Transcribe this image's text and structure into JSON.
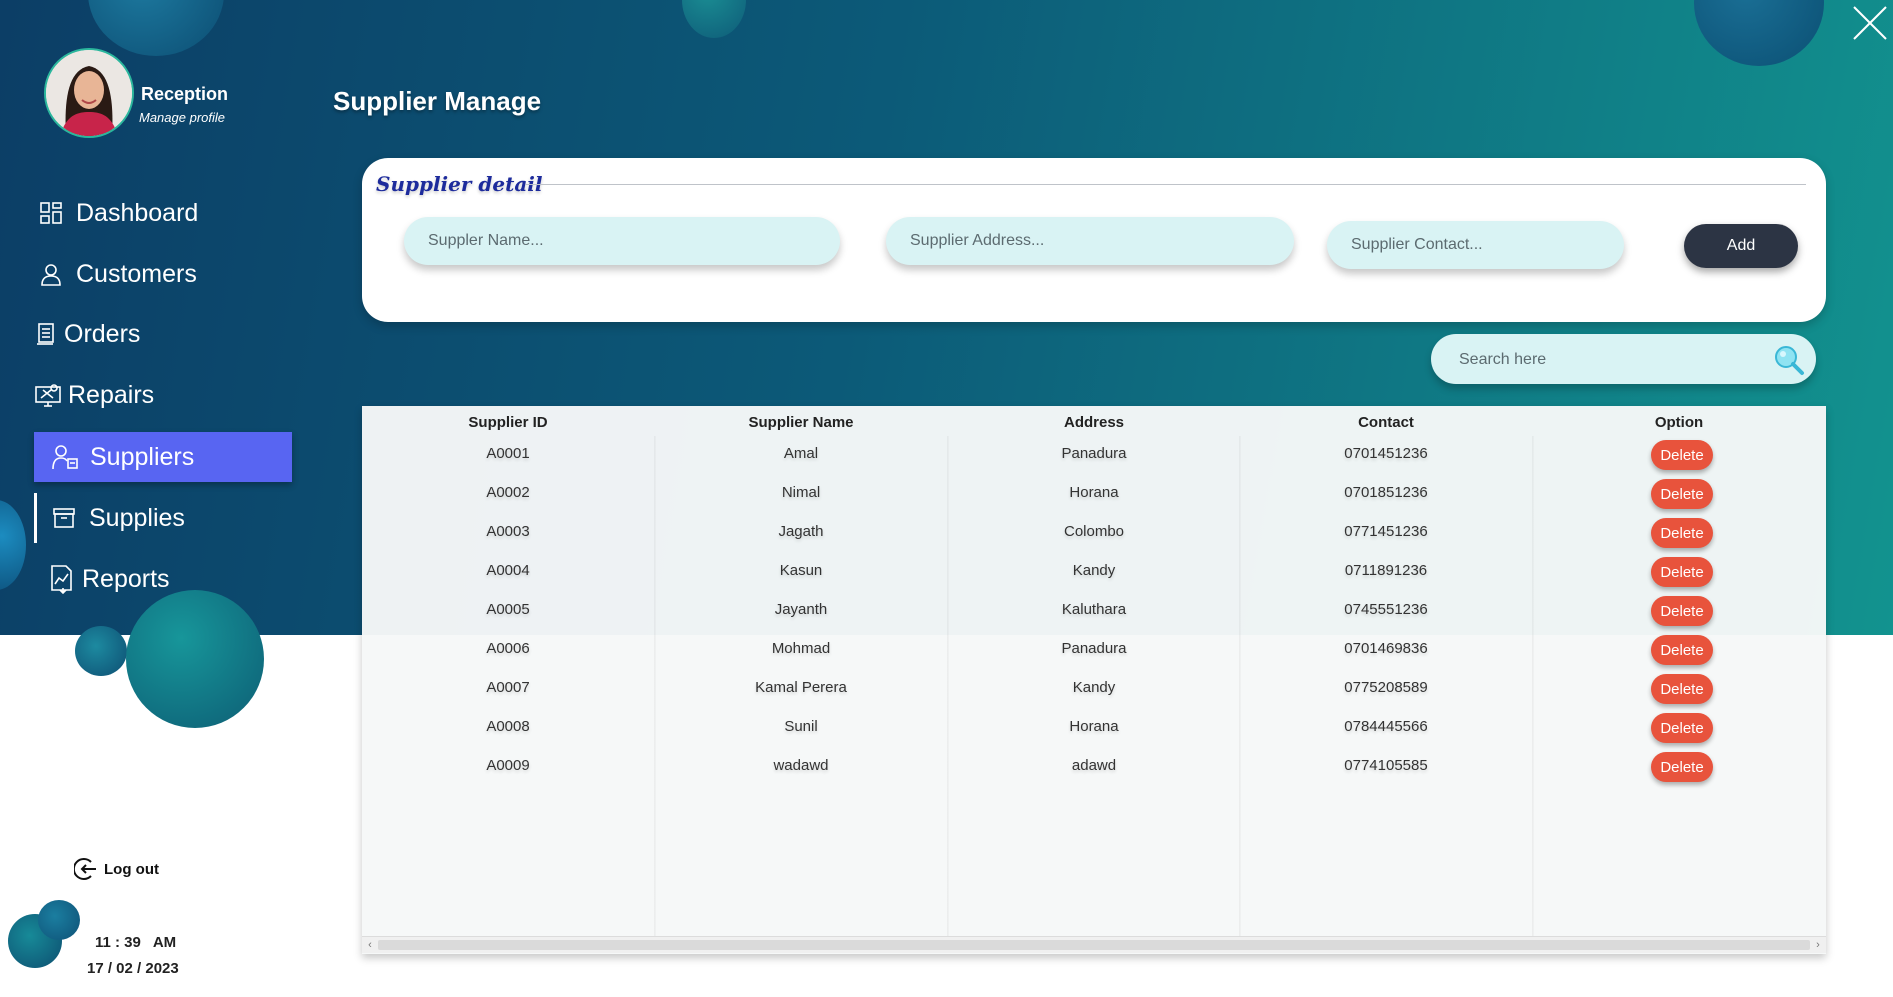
{
  "profile": {
    "name": "Reception",
    "manage_label": "Manage profile"
  },
  "page": {
    "title": "Supplier Manage"
  },
  "nav": {
    "dashboard": "Dashboard",
    "customers": "Customers",
    "orders": "Orders",
    "repairs": "Repairs",
    "suppliers": "Suppliers",
    "supplies": "Supplies",
    "reports": "Reports"
  },
  "form": {
    "title": "Supplier detail",
    "name_placeholder": "Suppler Name...",
    "address_placeholder": "Supplier Address...",
    "contact_placeholder": "Supplier Contact...",
    "add_label": "Add"
  },
  "search": {
    "placeholder": "Search here"
  },
  "table": {
    "headers": [
      "Supplier ID",
      "Supplier Name",
      "Address",
      "Contact",
      "Option"
    ],
    "delete_label": "Delete",
    "rows": [
      [
        "A0001",
        "Amal",
        "Panadura",
        "0701451236"
      ],
      [
        "A0002",
        "Nimal",
        "Horana",
        "0701851236"
      ],
      [
        "A0003",
        "Jagath",
        "Colombo",
        "0771451236"
      ],
      [
        "A0004",
        "Kasun",
        "Kandy",
        "0711891236"
      ],
      [
        "A0005",
        "Jayanth",
        "Kaluthara",
        "0745551236"
      ],
      [
        "A0006",
        "Mohmad",
        "Panadura",
        "0701469836"
      ],
      [
        "A0007",
        "Kamal Perera",
        "Kandy",
        "0775208589"
      ],
      [
        "A0008",
        "Sunil",
        "Horana",
        "0784445566"
      ],
      [
        "A0009",
        "wadawd",
        "adawd",
        "0774105585"
      ]
    ]
  },
  "footer": {
    "logout": "Log out",
    "time": "11 : 39   AM",
    "date": "17 / 02 / 2023"
  },
  "colors": {
    "accent": "#5865f2",
    "delete": "#e8533c",
    "add_button": "#2c3444",
    "title_blue": "#1d2b9c"
  },
  "icons": [
    "close-icon",
    "dashboard-icon",
    "customers-icon",
    "orders-icon",
    "repairs-icon",
    "suppliers-icon",
    "supplies-icon",
    "reports-icon",
    "search-icon",
    "logout-icon"
  ]
}
